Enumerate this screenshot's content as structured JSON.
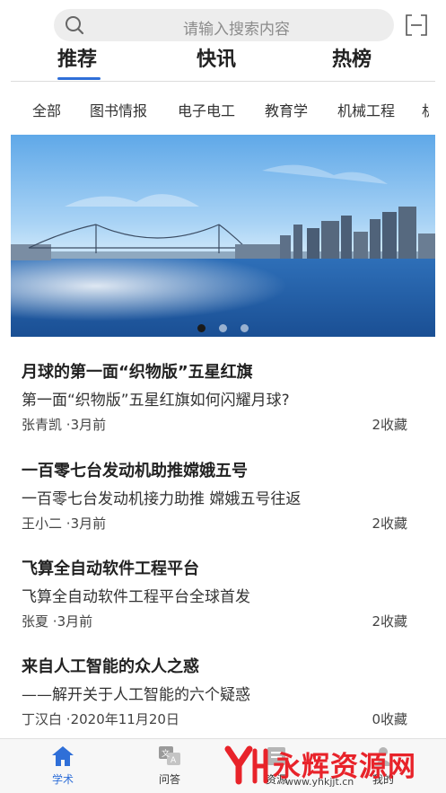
{
  "search": {
    "placeholder": "请输入搜索内容",
    "icon": "search-icon",
    "scan_icon": "scan-icon"
  },
  "main_tabs": [
    {
      "label": "推荐",
      "active": true
    },
    {
      "label": "快讯",
      "active": false
    },
    {
      "label": "热榜",
      "active": false
    }
  ],
  "sub_tabs": [
    "全部",
    "图书情报",
    "电子电工",
    "教育学",
    "机械工程",
    "机"
  ],
  "banner": {
    "slide_count": 3,
    "active_index": 0
  },
  "articles": [
    {
      "title": "月球的第一面“织物版”五星红旗",
      "subtitle": "第一面“织物版”五星红旗如何闪耀月球?",
      "author": "张青凯",
      "time": "·3月前",
      "favorites": "2收藏"
    },
    {
      "title": "一百零七台发动机助推嫦娥五号",
      "subtitle": "一百零七台发动机接力助推 嫦娥五号往返",
      "author": "王小二",
      "time": "·3月前",
      "favorites": "2收藏"
    },
    {
      "title": "飞算全自动软件工程平台",
      "subtitle": "飞算全自动软件工程平台全球首发",
      "author": "张夏",
      "time": "·3月前",
      "favorites": "2收藏"
    },
    {
      "title": "来自人工智能的众人之惑",
      "subtitle": "——解开关于人工智能的六个疑惑",
      "author": "丁汉白",
      "time": "·2020年11月20日",
      "favorites": "0收藏"
    }
  ],
  "bottom_nav": [
    {
      "label": "学术",
      "icon": "home-icon",
      "active": true
    },
    {
      "label": "问答",
      "icon": "qa-translate-icon",
      "active": false
    },
    {
      "label": "资源",
      "icon": "resource-icon",
      "active": false
    },
    {
      "label": "我的",
      "icon": "profile-icon",
      "active": false
    }
  ],
  "watermark": {
    "text": "永辉资源网",
    "url": "www.yhkjjt.cn"
  },
  "colors": {
    "accent": "#2f6fd8",
    "watermark_red": "#e8232a",
    "search_bg": "#ededed"
  }
}
